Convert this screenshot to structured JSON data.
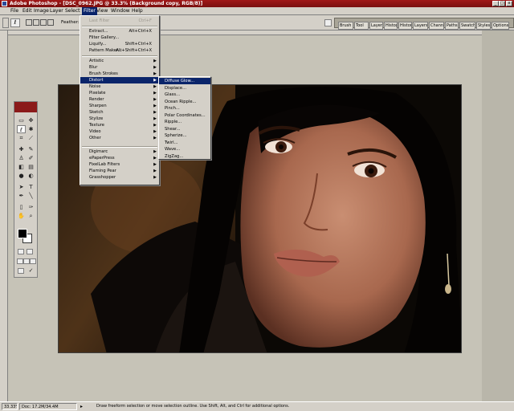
{
  "titlebar": {
    "title": "Adobe Photoshop - [DSC_0962.JPG @ 33.3% (Background copy, RGB/8)]",
    "min": "_",
    "max": "□",
    "close": "x"
  },
  "menubar": {
    "items": [
      "File",
      "Edit",
      "Image",
      "Layer",
      "Select",
      "Filter",
      "View",
      "Window",
      "Help"
    ]
  },
  "options": {
    "feather_label": "Feather:"
  },
  "palette_tabs": [
    "Brush",
    "Tool",
    "Layer",
    "Histog",
    "Histor",
    "Layers",
    "Channels",
    "Paths",
    "Swatches",
    "Styles",
    "Options"
  ],
  "filter_menu": {
    "last_filter": "Last Filter",
    "last_filter_sc": "Ctrl+F",
    "extract": "Extract...",
    "extract_sc": "Alt+Ctrl+X",
    "gallery": "Filter Gallery...",
    "liquify": "Liquify...",
    "liquify_sc": "Shift+Ctrl+X",
    "pattern": "Pattern Maker...",
    "pattern_sc": "Alt+Shift+Ctrl+X",
    "group1": [
      "Artistic",
      "Blur",
      "Brush Strokes",
      "Distort",
      "Noise",
      "Pixelate",
      "Render",
      "Sharpen",
      "Sketch",
      "Stylize",
      "Texture",
      "Video",
      "Other"
    ],
    "group2": [
      "Digimarc",
      "ePaperPress",
      "FixelLab Filters",
      "Flaming Pear",
      "Grasshopper"
    ],
    "highlighted": "Distort"
  },
  "distort_submenu": {
    "items": [
      "Diffuse Glow...",
      "Displace...",
      "Glass...",
      "Ocean Ripple...",
      "Pinch...",
      "Polar Coordinates...",
      "Ripple...",
      "Shear...",
      "Spherize...",
      "Twirl...",
      "Wave...",
      "ZigZag..."
    ],
    "highlighted": "Diffuse Glow..."
  },
  "status": {
    "zoom": "33.33%",
    "doc": "Doc: 17.2M/34.4M",
    "hint": "Draw freeform selection or move selection outline.  Use Shift, Alt, and Ctrl for additional options."
  },
  "colors": {
    "title_bg": "#8b1a1a",
    "highlight": "#0a246a",
    "chrome": "#d4d0c8"
  }
}
